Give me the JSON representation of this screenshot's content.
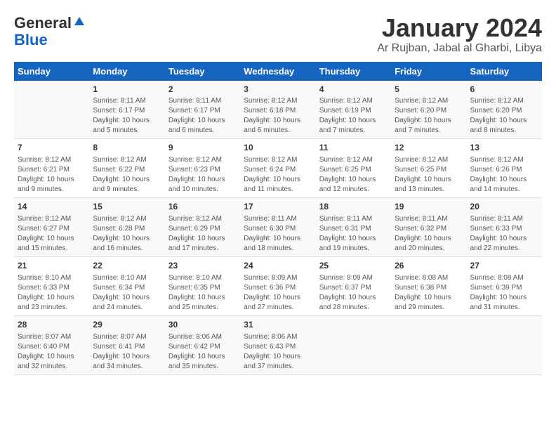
{
  "logo": {
    "general": "General",
    "blue": "Blue"
  },
  "title": "January 2024",
  "location": "Ar Rujban, Jabal al Gharbi, Libya",
  "headers": [
    "Sunday",
    "Monday",
    "Tuesday",
    "Wednesday",
    "Thursday",
    "Friday",
    "Saturday"
  ],
  "weeks": [
    [
      {
        "day": "",
        "lines": []
      },
      {
        "day": "1",
        "lines": [
          "Sunrise: 8:11 AM",
          "Sunset: 6:17 PM",
          "Daylight: 10 hours",
          "and 5 minutes."
        ]
      },
      {
        "day": "2",
        "lines": [
          "Sunrise: 8:11 AM",
          "Sunset: 6:17 PM",
          "Daylight: 10 hours",
          "and 6 minutes."
        ]
      },
      {
        "day": "3",
        "lines": [
          "Sunrise: 8:12 AM",
          "Sunset: 6:18 PM",
          "Daylight: 10 hours",
          "and 6 minutes."
        ]
      },
      {
        "day": "4",
        "lines": [
          "Sunrise: 8:12 AM",
          "Sunset: 6:19 PM",
          "Daylight: 10 hours",
          "and 7 minutes."
        ]
      },
      {
        "day": "5",
        "lines": [
          "Sunrise: 8:12 AM",
          "Sunset: 6:20 PM",
          "Daylight: 10 hours",
          "and 7 minutes."
        ]
      },
      {
        "day": "6",
        "lines": [
          "Sunrise: 8:12 AM",
          "Sunset: 6:20 PM",
          "Daylight: 10 hours",
          "and 8 minutes."
        ]
      }
    ],
    [
      {
        "day": "7",
        "lines": [
          "Sunrise: 8:12 AM",
          "Sunset: 6:21 PM",
          "Daylight: 10 hours",
          "and 9 minutes."
        ]
      },
      {
        "day": "8",
        "lines": [
          "Sunrise: 8:12 AM",
          "Sunset: 6:22 PM",
          "Daylight: 10 hours",
          "and 9 minutes."
        ]
      },
      {
        "day": "9",
        "lines": [
          "Sunrise: 8:12 AM",
          "Sunset: 6:23 PM",
          "Daylight: 10 hours",
          "and 10 minutes."
        ]
      },
      {
        "day": "10",
        "lines": [
          "Sunrise: 8:12 AM",
          "Sunset: 6:24 PM",
          "Daylight: 10 hours",
          "and 11 minutes."
        ]
      },
      {
        "day": "11",
        "lines": [
          "Sunrise: 8:12 AM",
          "Sunset: 6:25 PM",
          "Daylight: 10 hours",
          "and 12 minutes."
        ]
      },
      {
        "day": "12",
        "lines": [
          "Sunrise: 8:12 AM",
          "Sunset: 6:25 PM",
          "Daylight: 10 hours",
          "and 13 minutes."
        ]
      },
      {
        "day": "13",
        "lines": [
          "Sunrise: 8:12 AM",
          "Sunset: 6:26 PM",
          "Daylight: 10 hours",
          "and 14 minutes."
        ]
      }
    ],
    [
      {
        "day": "14",
        "lines": [
          "Sunrise: 8:12 AM",
          "Sunset: 6:27 PM",
          "Daylight: 10 hours",
          "and 15 minutes."
        ]
      },
      {
        "day": "15",
        "lines": [
          "Sunrise: 8:12 AM",
          "Sunset: 6:28 PM",
          "Daylight: 10 hours",
          "and 16 minutes."
        ]
      },
      {
        "day": "16",
        "lines": [
          "Sunrise: 8:12 AM",
          "Sunset: 6:29 PM",
          "Daylight: 10 hours",
          "and 17 minutes."
        ]
      },
      {
        "day": "17",
        "lines": [
          "Sunrise: 8:11 AM",
          "Sunset: 6:30 PM",
          "Daylight: 10 hours",
          "and 18 minutes."
        ]
      },
      {
        "day": "18",
        "lines": [
          "Sunrise: 8:11 AM",
          "Sunset: 6:31 PM",
          "Daylight: 10 hours",
          "and 19 minutes."
        ]
      },
      {
        "day": "19",
        "lines": [
          "Sunrise: 8:11 AM",
          "Sunset: 6:32 PM",
          "Daylight: 10 hours",
          "and 20 minutes."
        ]
      },
      {
        "day": "20",
        "lines": [
          "Sunrise: 8:11 AM",
          "Sunset: 6:33 PM",
          "Daylight: 10 hours",
          "and 22 minutes."
        ]
      }
    ],
    [
      {
        "day": "21",
        "lines": [
          "Sunrise: 8:10 AM",
          "Sunset: 6:33 PM",
          "Daylight: 10 hours",
          "and 23 minutes."
        ]
      },
      {
        "day": "22",
        "lines": [
          "Sunrise: 8:10 AM",
          "Sunset: 6:34 PM",
          "Daylight: 10 hours",
          "and 24 minutes."
        ]
      },
      {
        "day": "23",
        "lines": [
          "Sunrise: 8:10 AM",
          "Sunset: 6:35 PM",
          "Daylight: 10 hours",
          "and 25 minutes."
        ]
      },
      {
        "day": "24",
        "lines": [
          "Sunrise: 8:09 AM",
          "Sunset: 6:36 PM",
          "Daylight: 10 hours",
          "and 27 minutes."
        ]
      },
      {
        "day": "25",
        "lines": [
          "Sunrise: 8:09 AM",
          "Sunset: 6:37 PM",
          "Daylight: 10 hours",
          "and 28 minutes."
        ]
      },
      {
        "day": "26",
        "lines": [
          "Sunrise: 8:08 AM",
          "Sunset: 6:38 PM",
          "Daylight: 10 hours",
          "and 29 minutes."
        ]
      },
      {
        "day": "27",
        "lines": [
          "Sunrise: 8:08 AM",
          "Sunset: 6:39 PM",
          "Daylight: 10 hours",
          "and 31 minutes."
        ]
      }
    ],
    [
      {
        "day": "28",
        "lines": [
          "Sunrise: 8:07 AM",
          "Sunset: 6:40 PM",
          "Daylight: 10 hours",
          "and 32 minutes."
        ]
      },
      {
        "day": "29",
        "lines": [
          "Sunrise: 8:07 AM",
          "Sunset: 6:41 PM",
          "Daylight: 10 hours",
          "and 34 minutes."
        ]
      },
      {
        "day": "30",
        "lines": [
          "Sunrise: 8:06 AM",
          "Sunset: 6:42 PM",
          "Daylight: 10 hours",
          "and 35 minutes."
        ]
      },
      {
        "day": "31",
        "lines": [
          "Sunrise: 8:06 AM",
          "Sunset: 6:43 PM",
          "Daylight: 10 hours",
          "and 37 minutes."
        ]
      },
      {
        "day": "",
        "lines": []
      },
      {
        "day": "",
        "lines": []
      },
      {
        "day": "",
        "lines": []
      }
    ]
  ]
}
